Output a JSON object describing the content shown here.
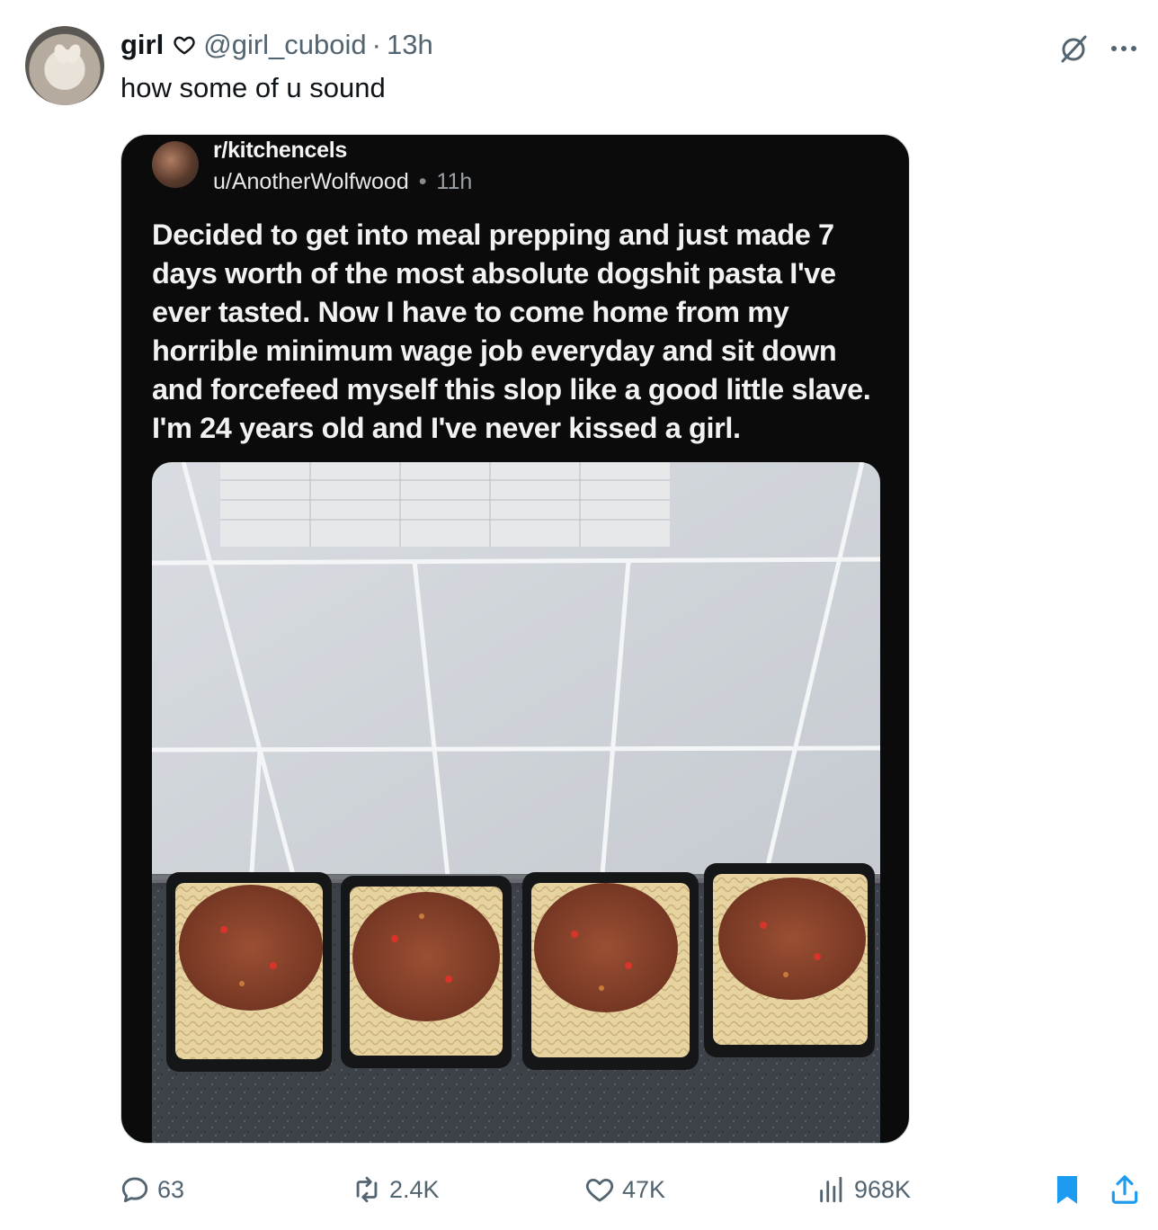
{
  "tweet": {
    "display_name": "girl",
    "handle": "@girl_cuboid",
    "separator": "·",
    "time": "13h",
    "text": "how some of u sound",
    "verified_icon": "heart-outline-icon"
  },
  "quoted_post": {
    "subreddit": "r/kitchencels",
    "user": "u/AnotherWolfwood",
    "separator": "•",
    "age": "11h",
    "title": "Decided to get into meal prepping and just made 7 days worth of the most absolute dogshit pasta I've ever tasted. Now I have to come home from my horrible minimum wage job everyday and sit down and forcefeed myself this slop like a good little slave. I'm 24 years old and I've never kissed a girl.",
    "photo_subject": "four plastic tubs of spaghetti bolognese on a dark counter in front of white tiles with a paper chart taped above"
  },
  "actions": {
    "replies": "63",
    "retweets": "2.4K",
    "likes": "47K",
    "views": "968K"
  },
  "colors": {
    "muted_text": "#536471",
    "bookmark_blue": "#1d9bf0",
    "card_bg": "#0b0b0c"
  }
}
